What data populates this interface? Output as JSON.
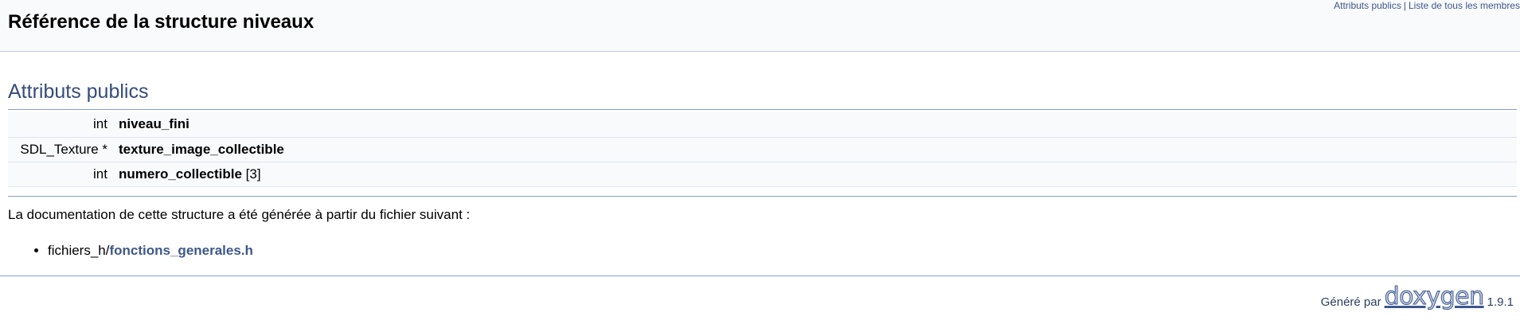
{
  "header": {
    "title": "Référence de la structure niveaux",
    "summary_links": [
      "Attributs publics",
      "Liste de tous les membres"
    ],
    "separator": "|"
  },
  "section": {
    "title": "Attributs publics"
  },
  "members": [
    {
      "type": "int",
      "name": "niveau_fini",
      "suffix": ""
    },
    {
      "type": "SDL_Texture *",
      "name": "texture_image_collectible",
      "suffix": ""
    },
    {
      "type": "int",
      "name": "numero_collectible",
      "suffix": " [3]"
    }
  ],
  "doc": {
    "text": "La documentation de cette structure a été générée à partir du fichier suivant :",
    "files": [
      {
        "dir": "fichiers_h/",
        "name": "fonctions_generales.h"
      }
    ]
  },
  "footer": {
    "generated_by": "Généré par",
    "logo": "doxygen",
    "version": "1.9.1"
  },
  "colors": {
    "link": "#3d578c",
    "heading": "#354c7b",
    "rule": "#879ecb",
    "row_bg": "#f9fafc"
  }
}
